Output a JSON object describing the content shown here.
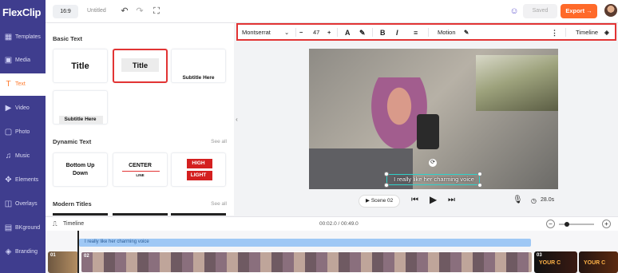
{
  "app": {
    "logo": "FlexClip"
  },
  "rail": {
    "items": [
      {
        "label": "Templates",
        "icon": "templates-icon"
      },
      {
        "label": "Media",
        "icon": "media-icon"
      },
      {
        "label": "Text",
        "icon": "text-icon",
        "active": true
      },
      {
        "label": "Video",
        "icon": "video-icon"
      },
      {
        "label": "Photo",
        "icon": "photo-icon"
      },
      {
        "label": "Music",
        "icon": "music-icon"
      },
      {
        "label": "Elements",
        "icon": "elements-icon"
      },
      {
        "label": "Overlays",
        "icon": "overlays-icon"
      },
      {
        "label": "BKground",
        "icon": "background-icon"
      },
      {
        "label": "Branding",
        "icon": "branding-icon"
      }
    ]
  },
  "topbar": {
    "ratio": "16:9",
    "title": "Untitled",
    "saved": "Saved",
    "export": "Export →"
  },
  "panel": {
    "basic_text": {
      "title": "Basic Text",
      "cards": [
        "Title",
        "Title",
        "Subtitle Here",
        "Subtitle Here"
      ]
    },
    "dynamic_text": {
      "title": "Dynamic Text",
      "see_all": "See all",
      "cards": {
        "card1": "Bottom Up Down",
        "card2_line1": "CENTER",
        "card2_line2": "LINE",
        "card3_line1": "HIGH",
        "card3_line2": "LIGHT"
      }
    },
    "modern_titles": {
      "title": "Modern Titles",
      "see_all": "See all"
    }
  },
  "text_toolbar": {
    "font": "Montserrat",
    "size": "47",
    "minus": "−",
    "plus": "+",
    "bold": "B",
    "italic": "I",
    "motion": "Motion",
    "timeline": "Timeline"
  },
  "canvas": {
    "subtitle": "I really like her charming voice"
  },
  "controls": {
    "scene": "Scene 02",
    "duration": "28.0s"
  },
  "timeline": {
    "label": "Timeline",
    "time": "00:02.0 / 00:49.0",
    "text_track": "I really like her charming voice",
    "clips": [
      {
        "num": "01",
        "text": ""
      },
      {
        "num": "02",
        "text": ""
      },
      {
        "num": "03",
        "text": "YOUR C"
      },
      {
        "num": "",
        "text": "YOUR C"
      }
    ]
  },
  "colors": {
    "rail_bg": "#3f3d8e",
    "accent": "#ff6a2a",
    "highlight_border": "#e23434"
  }
}
